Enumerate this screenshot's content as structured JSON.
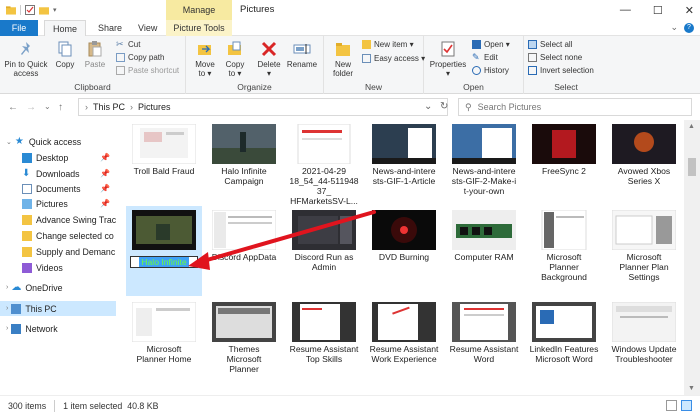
{
  "window": {
    "title": "Pictures",
    "manage_label": "Manage",
    "controls": {
      "minimize": "—",
      "maximize": "☐",
      "close": "✕"
    }
  },
  "tabs": {
    "file": "File",
    "home": "Home",
    "share": "Share",
    "view": "View",
    "picture_tools": "Picture Tools"
  },
  "ribbon": {
    "clipboard": {
      "label": "Clipboard",
      "pin": "Pin to Quick\naccess",
      "copy": "Copy",
      "paste": "Paste",
      "cut": "Cut",
      "copy_path": "Copy path",
      "paste_shortcut": "Paste shortcut"
    },
    "organize": {
      "label": "Organize",
      "move_to": "Move\nto ▾",
      "copy_to": "Copy\nto ▾",
      "delete": "Delete\n▾",
      "rename": "Rename"
    },
    "new": {
      "label": "New",
      "new_folder": "New\nfolder",
      "new_item": "New item ▾",
      "easy_access": "Easy access ▾"
    },
    "open": {
      "label": "Open",
      "properties": "Properties\n▾",
      "open": "Open ▾",
      "edit": "Edit",
      "history": "History"
    },
    "select": {
      "label": "Select",
      "select_all": "Select all",
      "select_none": "Select none",
      "invert_selection": "Invert selection"
    }
  },
  "address": {
    "crumbs": [
      "This PC",
      "Pictures"
    ],
    "search_placeholder": "Search Pictures"
  },
  "nav": {
    "quick_access": "Quick access",
    "items": [
      {
        "label": "Desktop",
        "pinned": true
      },
      {
        "label": "Downloads",
        "pinned": true
      },
      {
        "label": "Documents",
        "pinned": true
      },
      {
        "label": "Pictures",
        "pinned": true
      },
      {
        "label": "Advance Swing Trac",
        "pinned": false
      },
      {
        "label": "Change selected co",
        "pinned": false
      },
      {
        "label": "Supply and Demanc",
        "pinned": false
      },
      {
        "label": "Videos",
        "pinned": false
      }
    ],
    "onedrive": "OneDrive",
    "this_pc": "This PC",
    "network": "Network"
  },
  "files": [
    {
      "name": "Troll Bald Fraud"
    },
    {
      "name": "Halo Infinite\nCampaign"
    },
    {
      "name": "2021-04-29\n18_54_44-511948\n37_\nHFMarketsSV-L..."
    },
    {
      "name": "News-and-intere\nsts-GIF-1-Article"
    },
    {
      "name": "News-and-intere\nsts-GIF-2-Make-i\nt-your-own"
    },
    {
      "name": "FreeSync 2"
    },
    {
      "name": "Avowed Xbos\nSeries X"
    },
    {
      "name": "Halo Infinite",
      "renaming": true
    },
    {
      "name": "Discord AppData"
    },
    {
      "name": "Discord Run as\nAdmin"
    },
    {
      "name": "DVD Burning"
    },
    {
      "name": "Computer RAM"
    },
    {
      "name": "Microsoft\nPlanner\nBackground"
    },
    {
      "name": "Microsoft\nPlanner Plan\nSettings"
    },
    {
      "name": "Microsoft\nPlanner Home"
    },
    {
      "name": "Themes\nMicrosoft\nPlanner"
    },
    {
      "name": "Resume Assistant\nTop Skills"
    },
    {
      "name": "Resume Assistant\nWork Experience"
    },
    {
      "name": "Resume Assistant\nWord"
    },
    {
      "name": "LinkedIn Features\nMicrosoft Word"
    },
    {
      "name": "Windows Update\nTroubleshooter"
    }
  ],
  "status": {
    "item_count": "300 items",
    "selection": "1 item selected  40.8 KB"
  },
  "colors": {
    "accent": "#1979ca",
    "selection": "#cce8ff",
    "manage": "#f7eaa1",
    "arrow": "#e0141e"
  }
}
